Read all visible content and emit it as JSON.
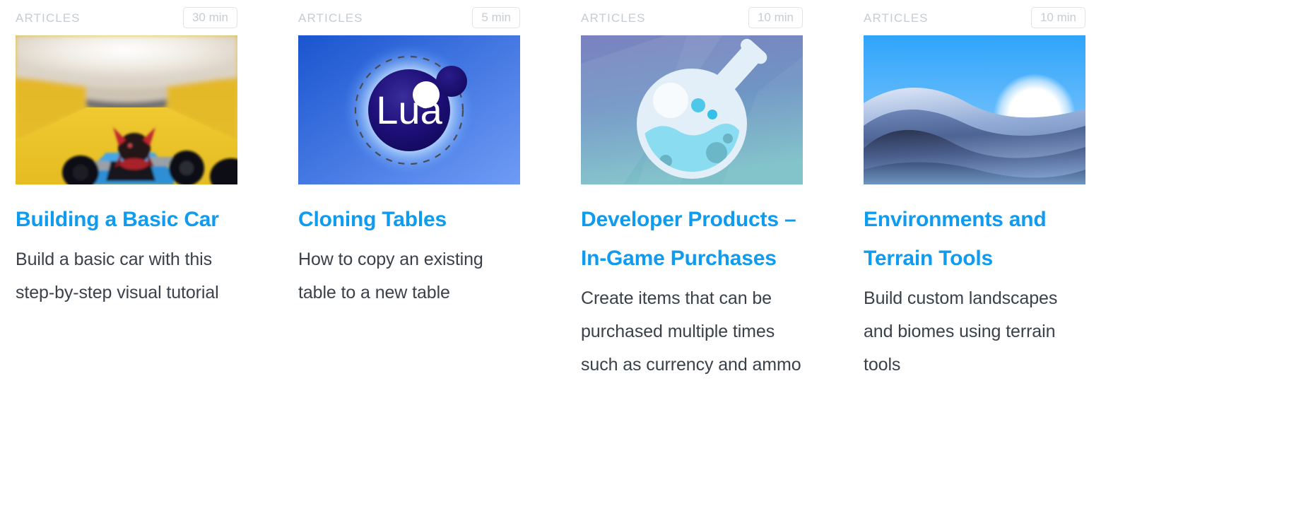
{
  "theme": {
    "title_color": "#0e9bf0",
    "body_color": "#394149",
    "meta_color": "#c6cdd2",
    "badge_border_color": "#dfe4e7",
    "page_background": "#ffffff"
  },
  "cards": [
    {
      "category": "ARTICLES",
      "duration": "30 min",
      "title": "Building a Basic Car",
      "description": "Build a basic car with this step-by-step visual tutorial",
      "thumbnail": "basic-car-thumbnail"
    },
    {
      "category": "ARTICLES",
      "duration": "5 min",
      "title": "Cloning Tables",
      "description": "How to copy an existing table to a new table",
      "thumbnail": "lua-logo-thumbnail"
    },
    {
      "category": "ARTICLES",
      "duration": "10 min",
      "title": "Developer Products – In-Game Purchases",
      "description": "Create items that can be purchased multiple times such as currency and ammo",
      "thumbnail": "flask-thumbnail"
    },
    {
      "category": "ARTICLES",
      "duration": "10 min",
      "title": "Environments and Terrain Tools",
      "description": "Build custom landscapes and biomes using terrain tools",
      "thumbnail": "terrain-hills-thumbnail"
    }
  ],
  "thumbnail_art": {
    "lua_wordmark": "Lua"
  }
}
